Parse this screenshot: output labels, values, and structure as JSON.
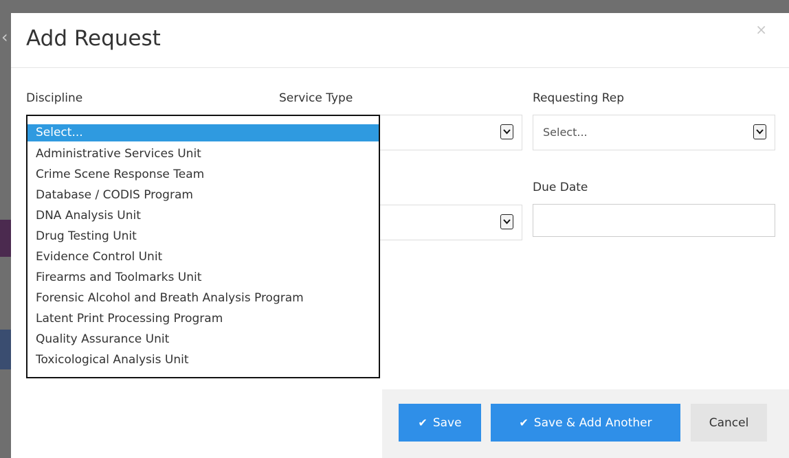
{
  "modal": {
    "title": "Add Request",
    "close_glyph": "×"
  },
  "fields": {
    "discipline": {
      "label": "Discipline"
    },
    "service_type": {
      "label": "Service Type"
    },
    "requesting_rep": {
      "label": "Requesting Rep",
      "value": "Select..."
    },
    "due_date": {
      "label": "Due Date",
      "value": ""
    }
  },
  "discipline_options": [
    "Select...",
    "Administrative Services Unit",
    "Crime Scene Response Team",
    "Database / CODIS Program",
    "DNA Analysis Unit",
    "Drug Testing Unit",
    "Evidence Control Unit",
    "Firearms and Toolmarks Unit",
    "Forensic Alcohol and Breath Analysis Program",
    "Latent Print Processing Program",
    "Quality Assurance Unit",
    "Toxicological Analysis Unit"
  ],
  "buttons": {
    "save": "Save",
    "save_add_another": "Save & Add Another",
    "cancel": "Cancel"
  },
  "icons": {
    "check": "✔",
    "chevron": "chevron-down-icon",
    "close": "close-icon"
  },
  "colors": {
    "primary": "#2f8fe8",
    "highlight": "#2f9ae0"
  }
}
